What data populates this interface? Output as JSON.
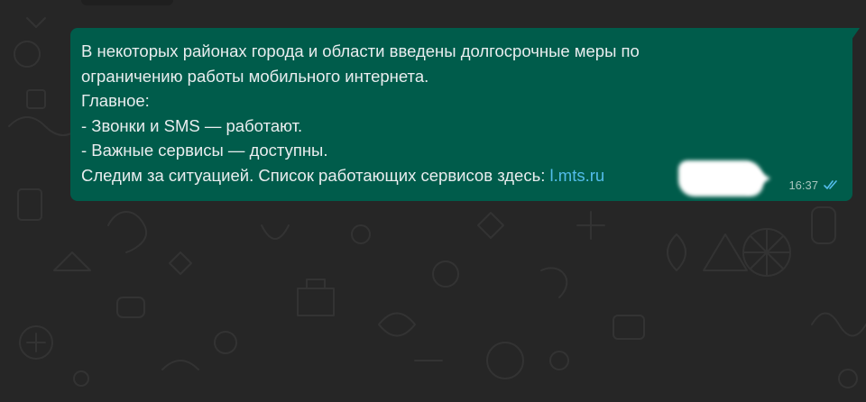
{
  "app": "WhatsApp",
  "colors": {
    "chat_background": "#262626",
    "bubble_outgoing": "#005c4b",
    "message_text": "#e9edef",
    "link": "#53bdeb",
    "timestamp": "#a8c6bf",
    "read_ticks": "#53bdeb"
  },
  "message": {
    "lines": [
      "В некоторых районах города и области введены долгосрочные меры по",
      "ограничению работы мобильного интернета.",
      "Главное:",
      "- Звонки и SMS — работают.",
      "- Важные сервисы — доступны."
    ],
    "last_line_text": "Следим за ситуацией. Список работающих сервисов здесь: ",
    "link_text": "l.mts.ru",
    "time": "16:37",
    "status_icon": "double-check-read-icon"
  }
}
